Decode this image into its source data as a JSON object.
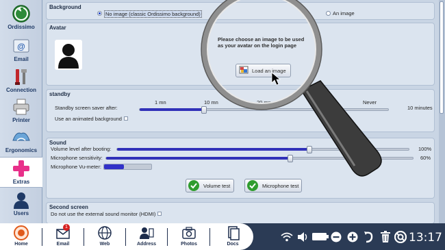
{
  "sidebar": {
    "items": [
      {
        "label": "Ordissimo",
        "icon": "back-arrow-icon"
      },
      {
        "label": "Email",
        "icon": "email-icon"
      },
      {
        "label": "Connection",
        "icon": "connection-tools-icon"
      },
      {
        "label": "Printer",
        "icon": "printer-icon"
      },
      {
        "label": "Ergonomics",
        "icon": "ergonomics-icon"
      },
      {
        "label": "Extras",
        "icon": "plus-icon"
      },
      {
        "label": "Users",
        "icon": "user-icon"
      }
    ],
    "active": "Extras"
  },
  "background": {
    "title": "Background",
    "option_no_image": "No image (classic Ordissimo background)",
    "option_an_image": "An image",
    "selected": "No image (classic Ordissimo background)"
  },
  "avatar": {
    "title": "Avatar",
    "prompt_line1": "Please choose an image to be used",
    "prompt_line2": "as your avatar on the login page",
    "load_button": "Load an image"
  },
  "standby": {
    "title": "standby",
    "saver_label": "Standby screen saver after:",
    "ticks": [
      "1 mn",
      "10 mn",
      "20 mn",
      "Never"
    ],
    "value_text": "10 minutes",
    "value_fraction": 0.26,
    "animated_label": "Use an animated background",
    "animated_checked": false
  },
  "sound": {
    "title": "Sound",
    "volume_label": "Volume level after booting:",
    "volume_value": "100%",
    "volume_fraction": 1.0,
    "mic_label": "Microphone sensitivity:",
    "mic_value": "60%",
    "mic_fraction": 0.6,
    "vu_label": "Microphone Vu-meter:",
    "vu_fraction": 0.42,
    "volume_test": "Volume test",
    "mic_test": "Microphone test"
  },
  "second_screen": {
    "title": "Second screen",
    "hdmi_label": "Do not use the external sound monitor (HDMI)",
    "hdmi_checked": false
  },
  "taskbar": {
    "items": [
      {
        "label": "Home",
        "icon": "home-icon"
      },
      {
        "label": "Email",
        "icon": "email-icon",
        "badge": "1"
      },
      {
        "label": "Web",
        "icon": "globe-icon"
      },
      {
        "label": "Address",
        "icon": "address-book-icon"
      },
      {
        "label": "Photos",
        "icon": "camera-icon"
      },
      {
        "label": "Docs",
        "icon": "documents-icon"
      }
    ],
    "tray_icons": [
      "wifi-icon",
      "volume-icon",
      "battery-icon",
      "zoom-out-icon",
      "zoom-in-icon",
      "undo-icon",
      "trash-icon",
      "help-lifebuoy-icon"
    ],
    "clock": "13:17"
  },
  "colors": {
    "accent_blue": "#3131b8",
    "taskbar_dark": "#2b3b55",
    "check_green": "#2f9c2f",
    "extras_pink": "#e8308a"
  }
}
